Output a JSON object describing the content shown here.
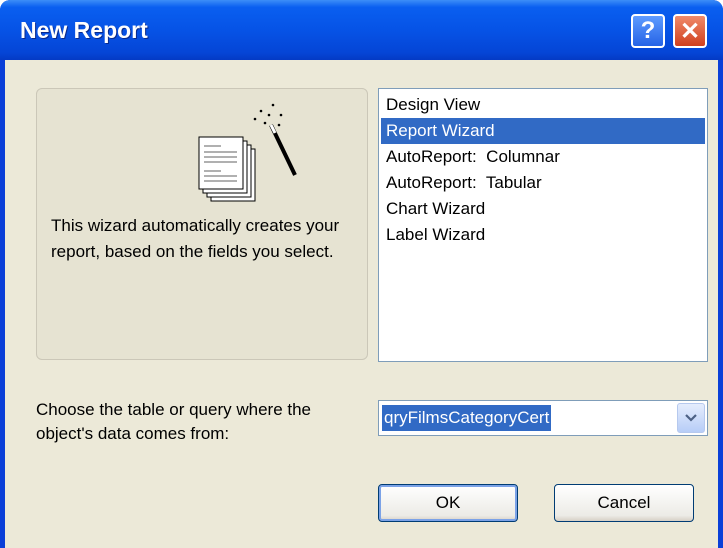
{
  "window": {
    "title": "New Report",
    "help_glyph": "?",
    "close_glyph": "✕"
  },
  "info": {
    "description": "This wizard automatically creates your report, based on the fields you select."
  },
  "report_types": {
    "items": [
      "Design View",
      "Report Wizard",
      "AutoReport:  Columnar",
      "AutoReport:  Tabular",
      "Chart Wizard",
      "Label Wizard"
    ],
    "selected": "Report Wizard"
  },
  "source": {
    "label": "Choose the table or query where the object's data comes from:",
    "value": "qryFilmsCategoryCert"
  },
  "buttons": {
    "ok": "OK",
    "cancel": "Cancel"
  },
  "colors": {
    "titlebar": "#0653e6",
    "selection": "#316ac5",
    "dialog_bg": "#ece9d8"
  }
}
